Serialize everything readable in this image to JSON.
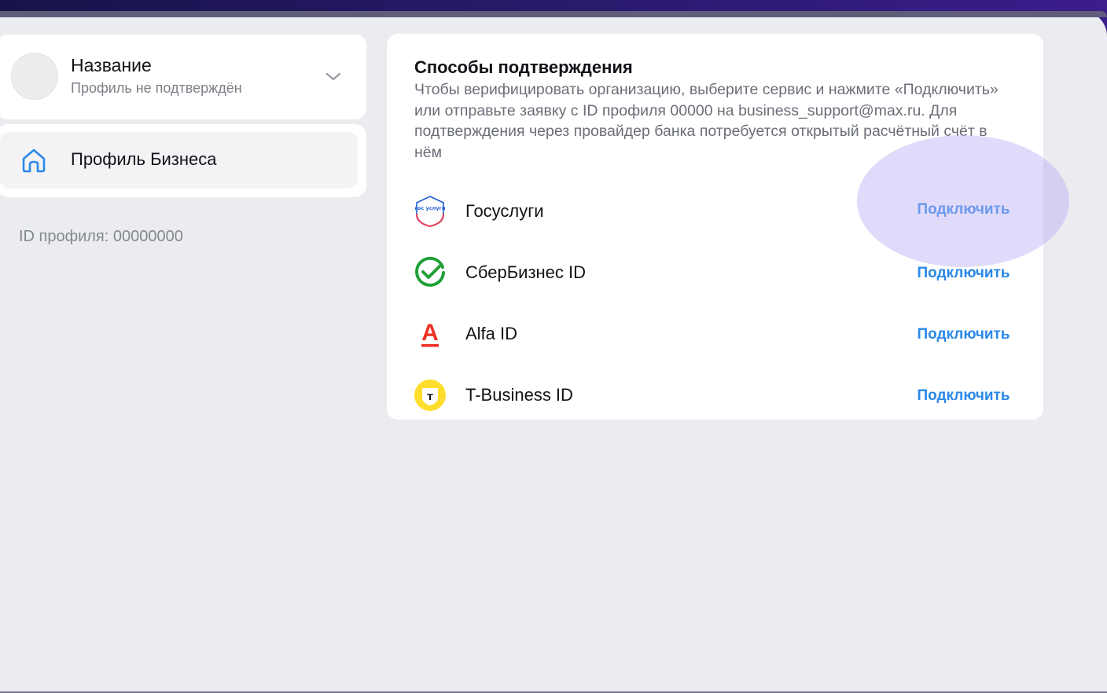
{
  "profile": {
    "name": "Название",
    "status": "Профиль не подтверждён"
  },
  "nav": {
    "items": [
      {
        "label": "Профиль Бизнеса",
        "icon": "home-icon",
        "active": true
      }
    ]
  },
  "profile_id_text": "ID профиля: 00000000",
  "verification": {
    "title": "Способы подтверждения",
    "description": "Чтобы верифицировать организацию, выберите сервис и нажмите «Подключить» или отправьте заявку с ID профиля 00000 на business_support@max.ru. Для подтверждения через провайдер банка потребуется открытый расчётный счёт в нём",
    "methods": [
      {
        "name": "Госуслуги",
        "icon": "gosuslugi-logo",
        "action": "Подключить",
        "logo_text": "гос услуги"
      },
      {
        "name": "СберБизнес ID",
        "icon": "sber-logo",
        "action": "Подключить"
      },
      {
        "name": "Alfa ID",
        "icon": "alfa-logo",
        "action": "Подключить",
        "logo_text": "A"
      },
      {
        "name": "T-Business ID",
        "icon": "tbank-logo",
        "action": "Подключить",
        "logo_text": "т"
      }
    ]
  },
  "colors": {
    "accent": "#2a88e8",
    "highlight": "#bab0f5",
    "sber_green": "#21a038",
    "alfa_red": "#ef3124",
    "tbank_yellow": "#ffdd2d"
  }
}
